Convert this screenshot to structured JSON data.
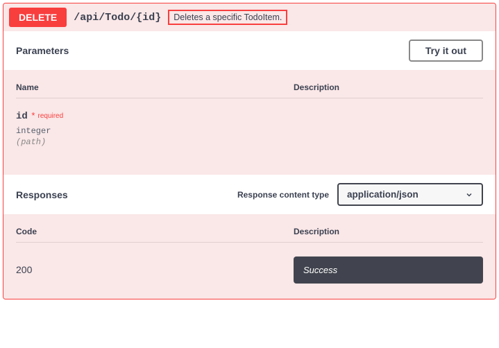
{
  "operation": {
    "method": "DELETE",
    "path": "/api/Todo/{id}",
    "summary": "Deletes a specific TodoItem."
  },
  "parameters": {
    "section_title": "Parameters",
    "try_label": "Try it out",
    "headers": {
      "name": "Name",
      "description": "Description"
    },
    "items": [
      {
        "name": "id",
        "required_label": "required",
        "type": "integer",
        "in": "(path)"
      }
    ]
  },
  "responses": {
    "section_title": "Responses",
    "content_type_label": "Response content type",
    "content_type_value": "application/json",
    "headers": {
      "code": "Code",
      "description": "Description"
    },
    "items": [
      {
        "code": "200",
        "description": "Success"
      }
    ]
  }
}
